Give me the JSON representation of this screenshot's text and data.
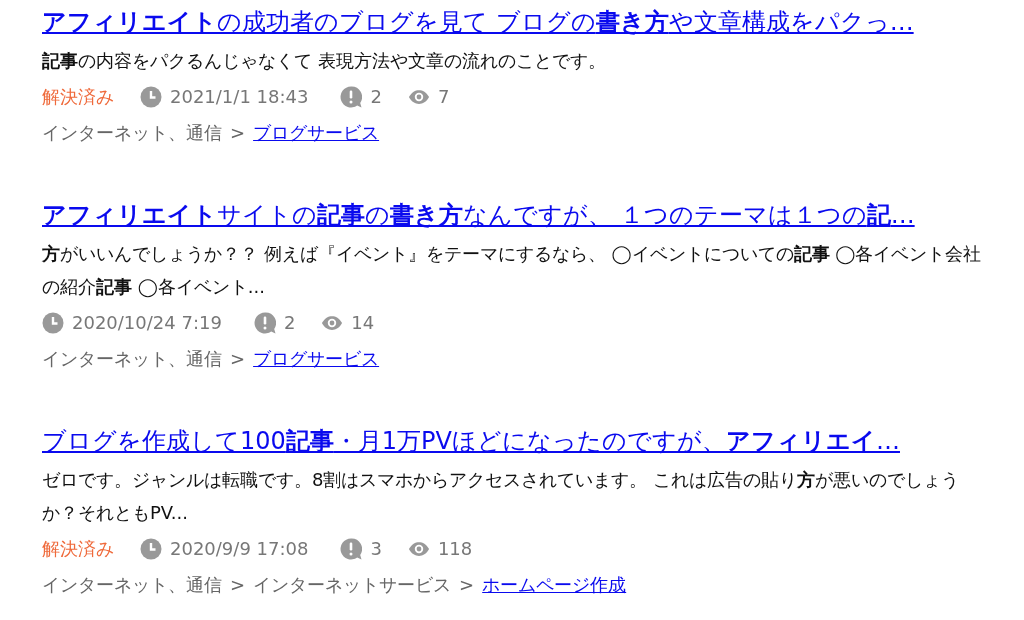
{
  "results": [
    {
      "title": "**アフィリエイト**の成功者のブログを見て ブログの**書き方**や文章構成をパクっ…",
      "snippet": "**記事**の内容をパクるんじゃなくて 表現方法や文章の流れのことです。",
      "resolved": true,
      "status_label": "解決済み",
      "date": "2021/1/1 18:43",
      "answers": "2",
      "views": "7",
      "breadcrumb": [
        {
          "kind": "category",
          "label": "インターネット、通信"
        },
        {
          "kind": "separator",
          "label": ">"
        },
        {
          "kind": "link",
          "label": "ブログサービス"
        }
      ]
    },
    {
      "title": "**アフィリエイト**サイトの**記事**の**書き方**なんですが、 １つのテーマは１つの**記**…",
      "snippet": "**方**がいいんでしょうか？？ 例えば『イベント』をテーマにするなら、 ◯イベントについての**記事** ◯各イベント会社の紹介**記事** ◯各イベント...",
      "resolved": false,
      "date": "2020/10/24 7:19",
      "answers": "2",
      "views": "14",
      "breadcrumb": [
        {
          "kind": "category",
          "label": "インターネット、通信"
        },
        {
          "kind": "separator",
          "label": ">"
        },
        {
          "kind": "link",
          "label": "ブログサービス"
        }
      ]
    },
    {
      "title": "ブログを作成して100**記事**・月1万PVほどになったのですが、**アフィリエイ**…",
      "snippet": "ゼロです。ジャンルは転職です。8割はスマホからアクセスされています。 これは広告の貼り**方**が悪いのでしょうか？それともPV...",
      "resolved": true,
      "status_label": "解決済み",
      "date": "2020/9/9 17:08",
      "answers": "3",
      "views": "118",
      "breadcrumb": [
        {
          "kind": "category",
          "label": "インターネット、通信"
        },
        {
          "kind": "separator",
          "label": ">"
        },
        {
          "kind": "category",
          "label": "インターネットサービス"
        },
        {
          "kind": "separator",
          "label": ">"
        },
        {
          "kind": "link",
          "label": "ホームページ作成"
        }
      ]
    }
  ]
}
